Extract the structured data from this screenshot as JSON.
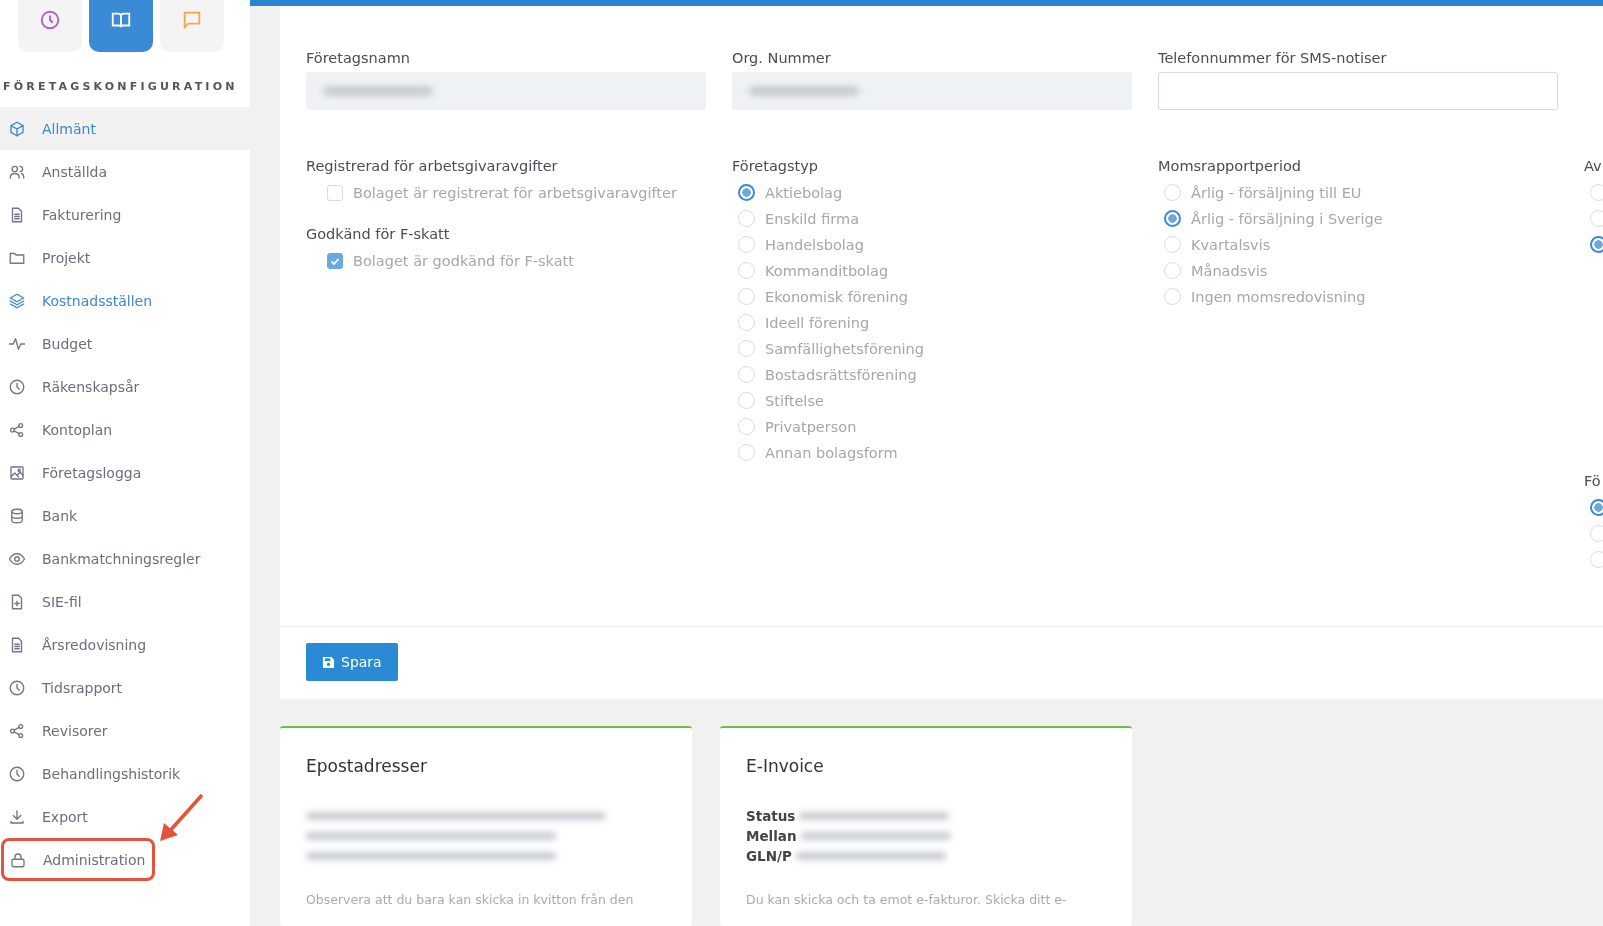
{
  "sidebar": {
    "top_tabs": [
      {
        "kind": "clock",
        "selected": false
      },
      {
        "kind": "book",
        "selected": true
      },
      {
        "kind": "chat",
        "selected": false
      }
    ],
    "heading": "FÖRETAGSKONFIGURATION",
    "items": [
      {
        "label": "Allmänt",
        "selected": true,
        "hovered": false,
        "highlighted": false
      },
      {
        "label": "Anställda",
        "selected": false,
        "hovered": false,
        "highlighted": false
      },
      {
        "label": "Fakturering",
        "selected": false,
        "hovered": false,
        "highlighted": false
      },
      {
        "label": "Projekt",
        "selected": false,
        "hovered": false,
        "highlighted": false
      },
      {
        "label": "Kostnadsställen",
        "selected": false,
        "hovered": true,
        "highlighted": false
      },
      {
        "label": "Budget",
        "selected": false,
        "hovered": false,
        "highlighted": false
      },
      {
        "label": "Räkenskapsår",
        "selected": false,
        "hovered": false,
        "highlighted": false
      },
      {
        "label": "Kontoplan",
        "selected": false,
        "hovered": false,
        "highlighted": false
      },
      {
        "label": "Företagslogga",
        "selected": false,
        "hovered": false,
        "highlighted": false
      },
      {
        "label": "Bank",
        "selected": false,
        "hovered": false,
        "highlighted": false
      },
      {
        "label": "Bankmatchningsregler",
        "selected": false,
        "hovered": false,
        "highlighted": false
      },
      {
        "label": "SIE-fil",
        "selected": false,
        "hovered": false,
        "highlighted": false
      },
      {
        "label": "Årsredovisning",
        "selected": false,
        "hovered": false,
        "highlighted": false
      },
      {
        "label": "Tidsrapport",
        "selected": false,
        "hovered": false,
        "highlighted": false
      },
      {
        "label": "Revisorer",
        "selected": false,
        "hovered": false,
        "highlighted": false
      },
      {
        "label": "Behandlingshistorik",
        "selected": false,
        "hovered": false,
        "highlighted": false
      },
      {
        "label": "Export",
        "selected": false,
        "hovered": false,
        "highlighted": false
      },
      {
        "label": "Administration",
        "selected": false,
        "hovered": false,
        "highlighted": true
      }
    ]
  },
  "form": {
    "fields": [
      {
        "label": "Företagsnamn",
        "disabled": true,
        "blurred": true
      },
      {
        "label": "Org. Nummer",
        "disabled": true,
        "blurred": true
      },
      {
        "label": "Telefonnummer för SMS-notiser",
        "disabled": false,
        "blurred": false
      }
    ],
    "groups": [
      [
        {
          "title": "Registrerad för arbetsgivaravgifter",
          "kind": "checkbox",
          "options": [
            {
              "label": "Bolaget är registrerat för arbetsgivaravgifter",
              "checked": false
            }
          ]
        },
        {
          "title": "Godkänd för F-skatt",
          "kind": "checkbox",
          "options": [
            {
              "label": "Bolaget är godkänd för F-skatt",
              "checked": true
            }
          ]
        }
      ],
      [
        {
          "title": "Företagstyp",
          "kind": "radio",
          "options": [
            {
              "label": "Aktiebolag",
              "selected": true
            },
            {
              "label": "Enskild firma",
              "selected": false
            },
            {
              "label": "Handelsbolag",
              "selected": false
            },
            {
              "label": "Kommanditbolag",
              "selected": false
            },
            {
              "label": "Ekonomisk förening",
              "selected": false
            },
            {
              "label": "Ideell förening",
              "selected": false
            },
            {
              "label": "Samfällighetsförening",
              "selected": false
            },
            {
              "label": "Bostadsrättsförening",
              "selected": false
            },
            {
              "label": "Stiftelse",
              "selected": false
            },
            {
              "label": "Privatperson",
              "selected": false
            },
            {
              "label": "Annan bolagsform",
              "selected": false
            }
          ]
        }
      ],
      [
        {
          "title": "Momsrapportperiod",
          "kind": "radio",
          "options": [
            {
              "label": "Årlig - försäljning till EU",
              "selected": false
            },
            {
              "label": "Årlig - försäljning i Sverige",
              "selected": true
            },
            {
              "label": "Kvartalsvis",
              "selected": false
            },
            {
              "label": "Månadsvis",
              "selected": false
            },
            {
              "label": "Ingen momsredovisning",
              "selected": false
            }
          ]
        }
      ],
      [
        {
          "title": "Av",
          "kind": "radio",
          "options": [
            {
              "selected": false
            },
            {
              "selected": false
            },
            {
              "selected": true
            }
          ]
        },
        {
          "title": "Fö",
          "kind": "radio",
          "options": [
            {
              "selected": true
            },
            {
              "selected": false
            },
            {
              "selected": false
            }
          ]
        }
      ]
    ],
    "save_button": "Spara"
  },
  "cards": [
    {
      "title": "Epostadresser",
      "note": "Observera att du bara kan skicka in kvitton från den"
    },
    {
      "title": "E-Invoice",
      "labels": [
        "Status",
        "Mellan",
        "GLN/P"
      ],
      "note": "Du kan skicka och ta emot e-fakturor. Skicka ditt e-"
    }
  ]
}
